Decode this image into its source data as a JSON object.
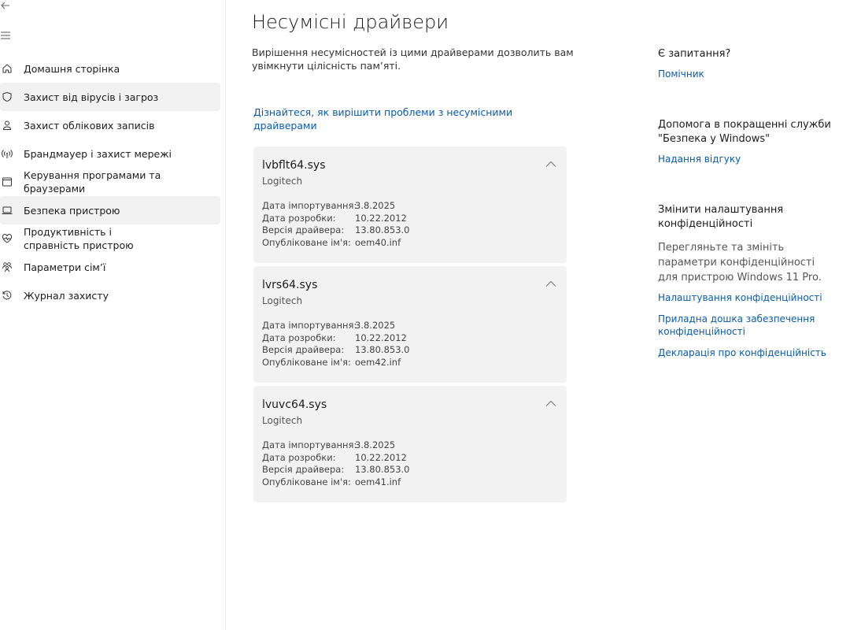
{
  "sidebar": {
    "items": [
      {
        "label": "Домашня сторінка",
        "icon": "home-icon"
      },
      {
        "label": "Захист від вірусів і загроз",
        "icon": "shield-icon",
        "selected": true
      },
      {
        "label": "Захист облікових записів",
        "icon": "person-icon"
      },
      {
        "label": "Брандмауер і захист мережі",
        "icon": "wifi-icon"
      },
      {
        "label": "Керування програмами та браузерами",
        "icon": "app-window-icon"
      },
      {
        "label": "Безпека пристрою",
        "icon": "laptop-icon",
        "selected": true
      },
      {
        "label": "Продуктивність і справність пристрою",
        "icon": "heart-icon"
      },
      {
        "label": "Параметри сім’ї",
        "icon": "family-icon"
      },
      {
        "label": "Журнал захисту",
        "icon": "history-icon"
      }
    ]
  },
  "main": {
    "title": "Несумісні драйвери",
    "description": "Вирішення несумісностей із цими драйверами дозволить вам увімкнути цілісність пам’яті.",
    "learn_link": "Дізнайтеся, як вирішити проблеми з несумісними драйверами",
    "labels": {
      "import_date": "Дата імпортування:",
      "dev_date": "Дата розробки:",
      "version": "Версія драйвера:",
      "published": "Опубліковане ім'я:"
    },
    "drivers": [
      {
        "name": "lvbflt64.sys",
        "vendor": "Logitech",
        "import_date": "3.8.2025",
        "dev_date": "10.22.2012",
        "version": "13.80.853.0",
        "published": "oem40.inf"
      },
      {
        "name": "lvrs64.sys",
        "vendor": "Logitech",
        "import_date": "3.8.2025",
        "dev_date": "10.22.2012",
        "version": "13.80.853.0",
        "published": "oem42.inf"
      },
      {
        "name": "lvuvc64.sys",
        "vendor": "Logitech",
        "import_date": "3.8.2025",
        "dev_date": "10.22.2012",
        "version": "13.80.853.0",
        "published": "oem41.inf"
      }
    ]
  },
  "right": {
    "question_title": "Є запитання?",
    "helper_link": "Помічник",
    "improve_title": "Допомога в покращенні служби \"Безпека у Windows\"",
    "feedback_link": "Надання відгуку",
    "privacy_title": "Змінити налаштування конфіденційності",
    "privacy_desc": "Перегляньте та змініть параметри конфіденційності для пристрою Windows 11 Pro.",
    "privacy_settings_link": "Налаштування конфіденційності",
    "dashboard_link": "Приладна дошка забезпечення конфіденційності",
    "statement_link": "Декларація про конфіденційність"
  },
  "colors": {
    "accent": "#0a5ba7",
    "card": "#f2f2f2",
    "selected": "#f1f1f1"
  }
}
